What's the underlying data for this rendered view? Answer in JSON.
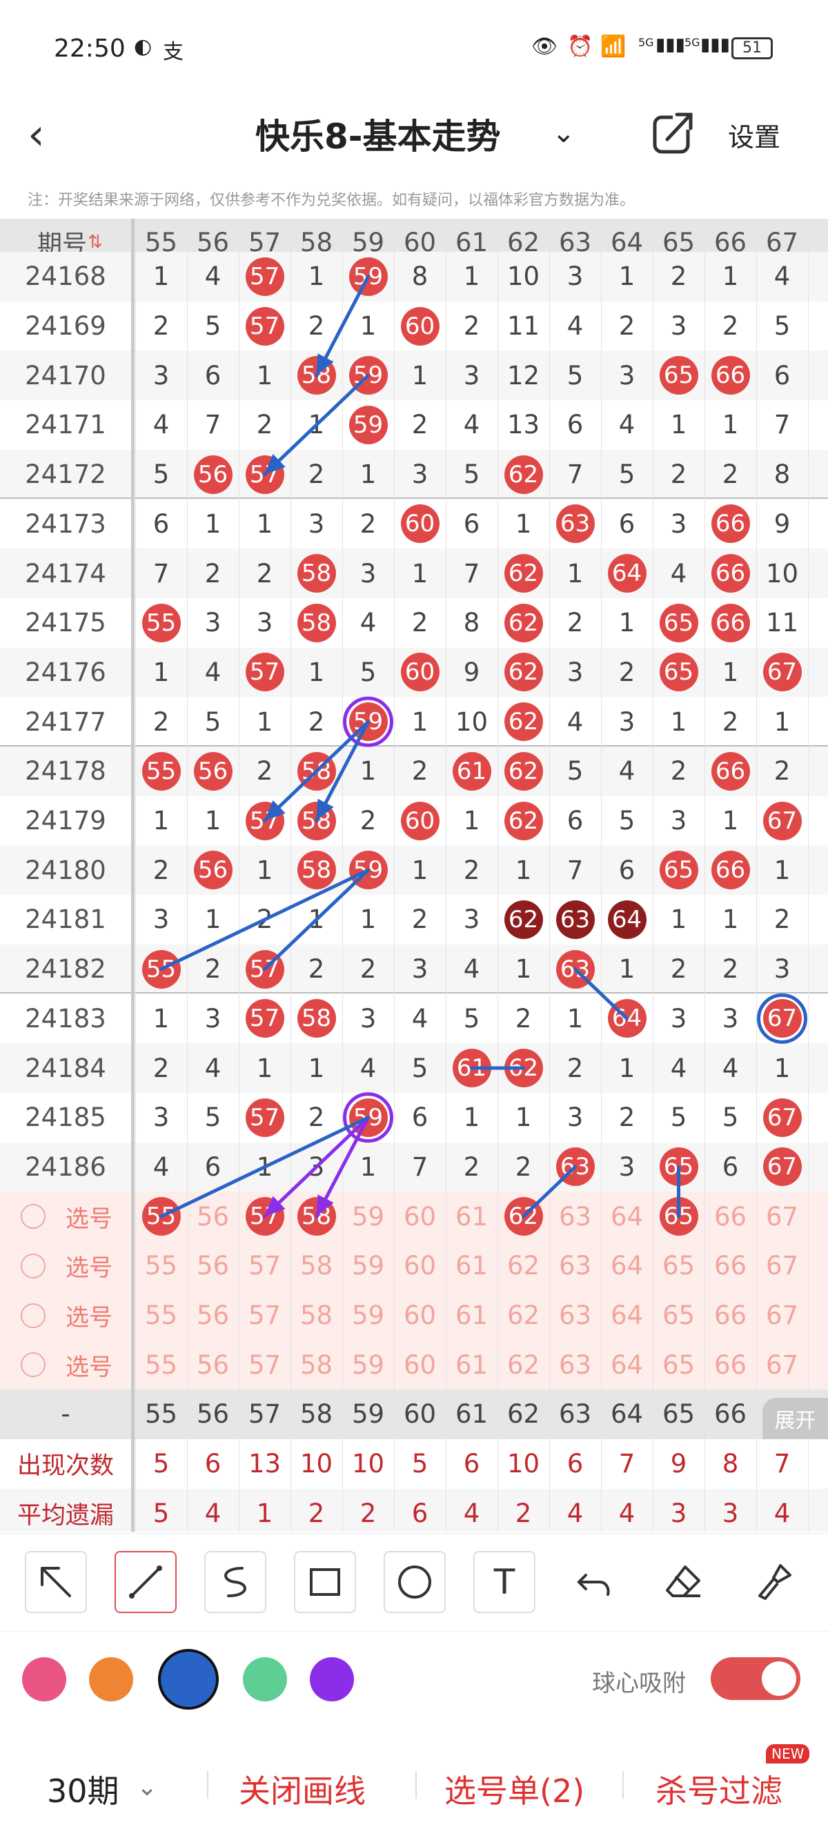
{
  "status_bar": {
    "time": "22:50",
    "battery": "51",
    "network_1": "5G",
    "network_2": "5G"
  },
  "header": {
    "title": "快乐8-基本走势",
    "settings_label": "设置"
  },
  "notice": "注：开奖结果来源于网络，仅供参考不作为兑奖依据。如有疑问，以福体彩官方数据为准。",
  "table": {
    "period_header": "期号",
    "columns": [
      "55",
      "56",
      "57",
      "58",
      "59",
      "60",
      "61",
      "62",
      "63",
      "64",
      "65",
      "66",
      "67"
    ],
    "rows": [
      {
        "period": "24168",
        "cells": [
          "1",
          "4",
          "57",
          "1",
          "59",
          "8",
          "1",
          "10",
          "3",
          "1",
          "2",
          "1",
          "4"
        ],
        "hits": [
          2,
          4
        ]
      },
      {
        "period": "24169",
        "cells": [
          "2",
          "5",
          "57",
          "2",
          "1",
          "60",
          "2",
          "11",
          "4",
          "2",
          "3",
          "2",
          "5"
        ],
        "hits": [
          2,
          5
        ]
      },
      {
        "period": "24170",
        "cells": [
          "3",
          "6",
          "1",
          "58",
          "59",
          "1",
          "3",
          "12",
          "5",
          "3",
          "65",
          "66",
          "6"
        ],
        "hits": [
          3,
          4,
          10,
          11
        ]
      },
      {
        "period": "24171",
        "cells": [
          "4",
          "7",
          "2",
          "1",
          "59",
          "2",
          "4",
          "13",
          "6",
          "4",
          "1",
          "1",
          "7"
        ],
        "hits": [
          4
        ]
      },
      {
        "period": "24172",
        "cells": [
          "5",
          "56",
          "57",
          "2",
          "1",
          "3",
          "5",
          "62",
          "7",
          "5",
          "2",
          "2",
          "8"
        ],
        "hits": [
          1,
          2,
          7
        ]
      },
      {
        "period": "24173",
        "cells": [
          "6",
          "1",
          "1",
          "3",
          "2",
          "60",
          "6",
          "1",
          "63",
          "6",
          "3",
          "66",
          "9"
        ],
        "hits": [
          5,
          8,
          11
        ]
      },
      {
        "period": "24174",
        "cells": [
          "7",
          "2",
          "2",
          "58",
          "3",
          "1",
          "7",
          "62",
          "1",
          "64",
          "4",
          "66",
          "10"
        ],
        "hits": [
          3,
          7,
          9,
          11
        ]
      },
      {
        "period": "24175",
        "cells": [
          "55",
          "3",
          "3",
          "58",
          "4",
          "2",
          "8",
          "62",
          "2",
          "1",
          "65",
          "66",
          "11"
        ],
        "hits": [
          0,
          3,
          7,
          10,
          11
        ]
      },
      {
        "period": "24176",
        "cells": [
          "1",
          "4",
          "57",
          "1",
          "5",
          "60",
          "9",
          "62",
          "3",
          "2",
          "65",
          "1",
          "67"
        ],
        "hits": [
          2,
          5,
          7,
          10,
          12
        ]
      },
      {
        "period": "24177",
        "cells": [
          "2",
          "5",
          "1",
          "2",
          "59",
          "1",
          "10",
          "62",
          "4",
          "3",
          "1",
          "2",
          "1"
        ],
        "hits": [
          4,
          7
        ]
      },
      {
        "period": "24178",
        "cells": [
          "55",
          "56",
          "2",
          "58",
          "1",
          "2",
          "61",
          "62",
          "5",
          "4",
          "2",
          "66",
          "2"
        ],
        "hits": [
          0,
          1,
          3,
          6,
          7,
          11
        ]
      },
      {
        "period": "24179",
        "cells": [
          "1",
          "1",
          "57",
          "58",
          "2",
          "60",
          "1",
          "62",
          "6",
          "5",
          "3",
          "1",
          "67"
        ],
        "hits": [
          2,
          3,
          5,
          7,
          12
        ]
      },
      {
        "period": "24180",
        "cells": [
          "2",
          "56",
          "1",
          "58",
          "59",
          "1",
          "2",
          "1",
          "7",
          "6",
          "65",
          "66",
          "1"
        ],
        "hits": [
          1,
          3,
          4,
          10,
          11
        ]
      },
      {
        "period": "24181",
        "cells": [
          "3",
          "1",
          "2",
          "1",
          "1",
          "2",
          "3",
          "62",
          "63",
          "64",
          "1",
          "1",
          "2"
        ],
        "hits": [
          7,
          8,
          9
        ],
        "dark_hits": [
          7,
          8,
          9
        ]
      },
      {
        "period": "24182",
        "cells": [
          "55",
          "2",
          "57",
          "2",
          "2",
          "3",
          "4",
          "1",
          "63",
          "1",
          "2",
          "2",
          "3"
        ],
        "hits": [
          0,
          2,
          8
        ]
      },
      {
        "period": "24183",
        "cells": [
          "1",
          "3",
          "57",
          "58",
          "3",
          "4",
          "5",
          "2",
          "1",
          "64",
          "3",
          "3",
          "67"
        ],
        "hits": [
          2,
          3,
          9,
          12
        ]
      },
      {
        "period": "24184",
        "cells": [
          "2",
          "4",
          "1",
          "1",
          "4",
          "5",
          "61",
          "62",
          "2",
          "1",
          "4",
          "4",
          "1"
        ],
        "hits": [
          6,
          7
        ]
      },
      {
        "period": "24185",
        "cells": [
          "3",
          "5",
          "57",
          "2",
          "59",
          "6",
          "1",
          "1",
          "3",
          "2",
          "5",
          "5",
          "67"
        ],
        "hits": [
          2,
          4,
          12
        ]
      },
      {
        "period": "24186",
        "cells": [
          "4",
          "6",
          "1",
          "3",
          "1",
          "7",
          "2",
          "2",
          "63",
          "3",
          "65",
          "6",
          "67"
        ],
        "hits": [
          8,
          10,
          12
        ]
      }
    ],
    "select_rows": [
      {
        "label": "选号",
        "hits": [
          0,
          2,
          3,
          7,
          10
        ]
      },
      {
        "label": "选号",
        "hits": []
      },
      {
        "label": "选号",
        "hits": []
      },
      {
        "label": "选号",
        "hits": []
      }
    ],
    "footer_header": {
      "label": "-",
      "values": [
        "55",
        "56",
        "57",
        "58",
        "59",
        "60",
        "61",
        "62",
        "63",
        "64",
        "65",
        "66"
      ],
      "expand_label": "展开"
    },
    "occurrence": {
      "label": "出现次数",
      "values": [
        "5",
        "6",
        "13",
        "10",
        "10",
        "5",
        "6",
        "10",
        "6",
        "7",
        "9",
        "8",
        "7"
      ]
    },
    "avg_miss": {
      "label": "平均遗漏",
      "values": [
        "5",
        "4",
        "1",
        "2",
        "2",
        "6",
        "4",
        "2",
        "4",
        "4",
        "3",
        "3",
        "4"
      ]
    }
  },
  "tools": [
    "arrow-tool",
    "line-tool",
    "curve-tool",
    "rectangle-tool",
    "circle-tool",
    "text-tool",
    "undo-tool",
    "eraser-tool",
    "clear-tool"
  ],
  "text_tool_label": "T",
  "colors": {
    "pink": "#e95482",
    "orange": "#ef8533",
    "blue": "#2a63c6",
    "green": "#5dcf94",
    "purple": "#8a2ee8",
    "selected": "blue",
    "red_ball": "#e04848",
    "dark_ball": "#8e1d1d"
  },
  "snap_label": "球心吸附",
  "snap_enabled": true,
  "bottom_bar": {
    "period_select": "30期",
    "close_lines": "关闭画线",
    "pick_list": "选号单(2)",
    "filter": "杀号过滤",
    "new_badge": "NEW"
  }
}
